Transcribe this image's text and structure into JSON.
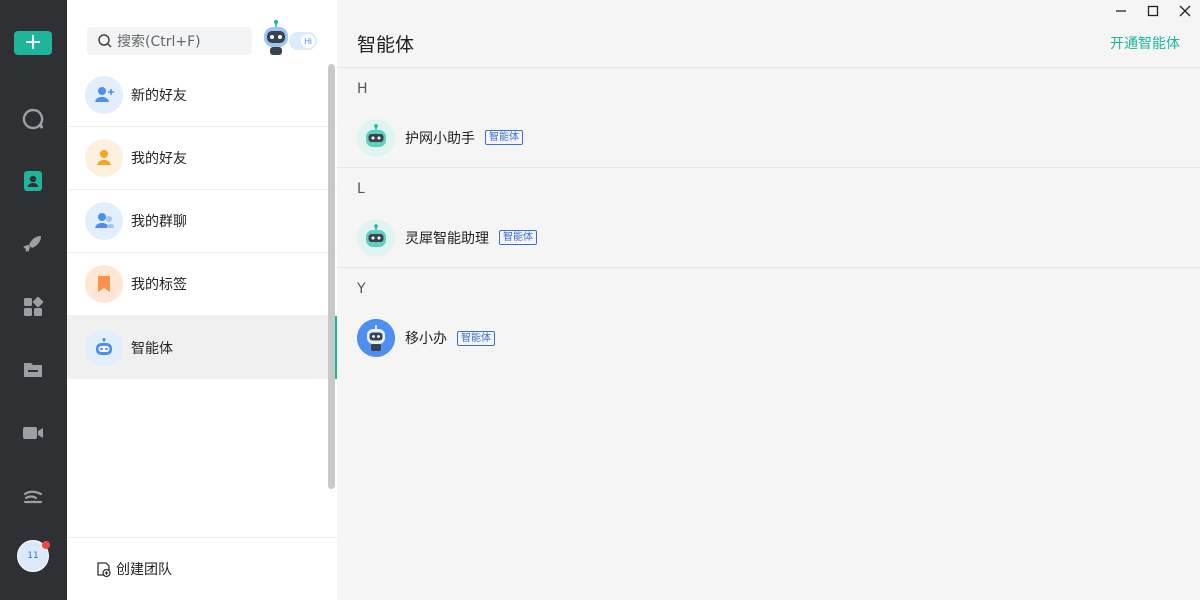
{
  "rail": {
    "add_label": "+",
    "items": [
      {
        "name": "chat-icon"
      },
      {
        "name": "contacts-icon"
      },
      {
        "name": "rocket-icon"
      },
      {
        "name": "apps-icon"
      },
      {
        "name": "folder-icon"
      },
      {
        "name": "video-icon"
      },
      {
        "name": "cloud-icon"
      }
    ],
    "avatar_text": "11"
  },
  "search": {
    "placeholder": "搜索(Ctrl+F)"
  },
  "nav": {
    "items": [
      {
        "label": "新的好友",
        "icon": "add-user-icon",
        "color": "#4d8ef0",
        "bg": "#e3eefd"
      },
      {
        "label": "我的好友",
        "icon": "user-icon",
        "color": "#f5a623",
        "bg": "#fdf0dc"
      },
      {
        "label": "我的群聊",
        "icon": "group-icon",
        "color": "#4d8ef0",
        "bg": "#e3eefd"
      },
      {
        "label": "我的标签",
        "icon": "tag-icon",
        "color": "#f5934a",
        "bg": "#fde6d4"
      },
      {
        "label": "智能体",
        "icon": "robot-icon",
        "color": "#4d8ef0",
        "bg": "#e3eefd"
      }
    ],
    "create_team": "创建团队"
  },
  "main": {
    "title": "智能体",
    "open_agent": "开通智能体",
    "sections": [
      {
        "letter": "H",
        "agents": [
          {
            "name": "护网小助手",
            "tag": "智能体",
            "avatar": "teal-robot-icon"
          }
        ]
      },
      {
        "letter": "L",
        "agents": [
          {
            "name": "灵犀智能助理",
            "tag": "智能体",
            "avatar": "teal-robot-icon"
          }
        ]
      },
      {
        "letter": "Y",
        "agents": [
          {
            "name": "移小办",
            "tag": "智能体",
            "avatar": "blue-robot-icon"
          }
        ]
      }
    ]
  },
  "colors": {
    "accent": "#1fb59c",
    "rail_bg": "#2e3033",
    "tag_blue": "#3a6fd8"
  }
}
